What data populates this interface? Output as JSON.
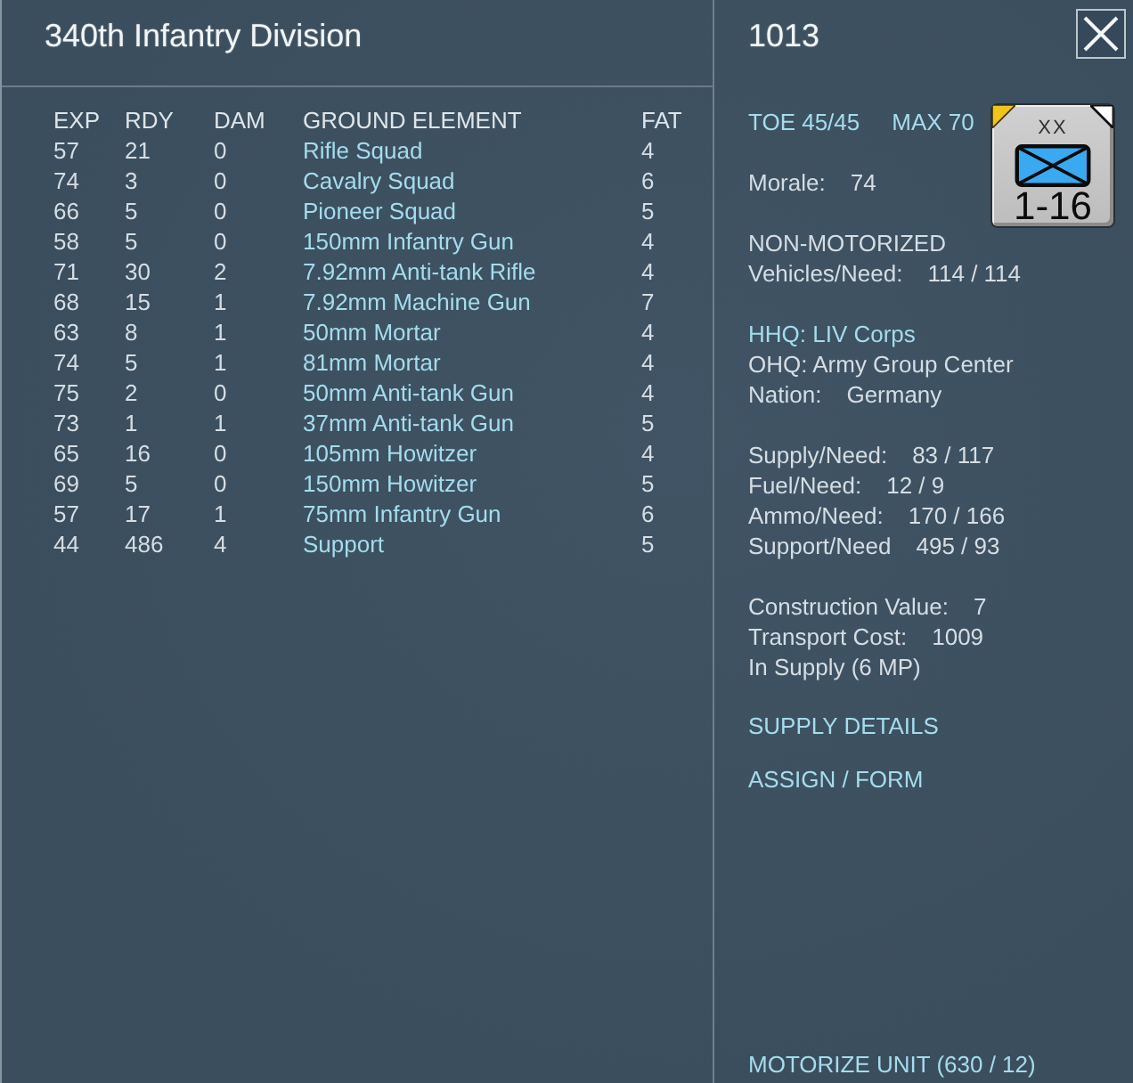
{
  "left_panel": {
    "title": "340th Infantry Division",
    "table": {
      "columns": [
        "EXP",
        "RDY",
        "DAM",
        "GROUND ELEMENT",
        "FAT"
      ],
      "rows": [
        {
          "exp": "57",
          "rdy": "21",
          "dam": "0",
          "element": "Rifle Squad",
          "fat": "4"
        },
        {
          "exp": "74",
          "rdy": "3",
          "dam": "0",
          "element": "Cavalry Squad",
          "fat": "6"
        },
        {
          "exp": "66",
          "rdy": "5",
          "dam": "0",
          "element": "Pioneer Squad",
          "fat": "5"
        },
        {
          "exp": "58",
          "rdy": "5",
          "dam": "0",
          "element": "150mm Infantry Gun",
          "fat": "4"
        },
        {
          "exp": "71",
          "rdy": "30",
          "dam": "2",
          "element": "7.92mm Anti-tank Rifle",
          "fat": "4"
        },
        {
          "exp": "68",
          "rdy": "15",
          "dam": "1",
          "element": "7.92mm Machine Gun",
          "fat": "7"
        },
        {
          "exp": "63",
          "rdy": "8",
          "dam": "1",
          "element": "50mm Mortar",
          "fat": "4"
        },
        {
          "exp": "74",
          "rdy": "5",
          "dam": "1",
          "element": "81mm Mortar",
          "fat": "4"
        },
        {
          "exp": "75",
          "rdy": "2",
          "dam": "0",
          "element": "50mm Anti-tank Gun",
          "fat": "4"
        },
        {
          "exp": "73",
          "rdy": "1",
          "dam": "1",
          "element": "37mm Anti-tank Gun",
          "fat": "5"
        },
        {
          "exp": "65",
          "rdy": "16",
          "dam": "0",
          "element": "105mm Howitzer",
          "fat": "4"
        },
        {
          "exp": "69",
          "rdy": "5",
          "dam": "0",
          "element": "150mm Howitzer",
          "fat": "5"
        },
        {
          "exp": "57",
          "rdy": "17",
          "dam": "1",
          "element": "75mm Infantry Gun",
          "fat": "6"
        },
        {
          "exp": "44",
          "rdy": "486",
          "dam": "4",
          "element": "Support",
          "fat": "5"
        }
      ]
    }
  },
  "right_panel": {
    "title": "1013",
    "strength": {
      "toe": "TOE 45/45",
      "max": "MAX 70"
    },
    "counter": {
      "size": "XX",
      "rating": "1-16"
    },
    "sections": [
      [
        {
          "kind": "stat",
          "label": "Morale:",
          "value": "74"
        }
      ],
      [
        {
          "kind": "text",
          "text": "NON-MOTORIZED"
        },
        {
          "kind": "stat",
          "label": "Vehicles/Need:",
          "value": "114 / 114"
        }
      ],
      [
        {
          "kind": "link",
          "text": "HHQ: LIV Corps"
        },
        {
          "kind": "text",
          "text": "OHQ: Army Group Center"
        },
        {
          "kind": "stat",
          "label": "Nation:",
          "value": "Germany"
        }
      ],
      [
        {
          "kind": "stat",
          "label": "Supply/Need:",
          "value": "83 / 117"
        },
        {
          "kind": "stat",
          "label": "Fuel/Need:",
          "value": "12 / 9"
        },
        {
          "kind": "stat",
          "label": "Ammo/Need:",
          "value": "170 / 166"
        },
        {
          "kind": "stat",
          "label": "Support/Need",
          "value": "495 / 93"
        }
      ],
      [
        {
          "kind": "stat",
          "label": "Construction Value:",
          "value": "7"
        },
        {
          "kind": "stat",
          "label": "Transport Cost:",
          "value": "1009"
        },
        {
          "kind": "text",
          "text": "In Supply (6 MP)"
        }
      ]
    ],
    "actions": [
      "SUPPLY DETAILS",
      "ASSIGN / FORM"
    ],
    "footer_action": "MOTORIZE UNIT (630 / 12)"
  }
}
